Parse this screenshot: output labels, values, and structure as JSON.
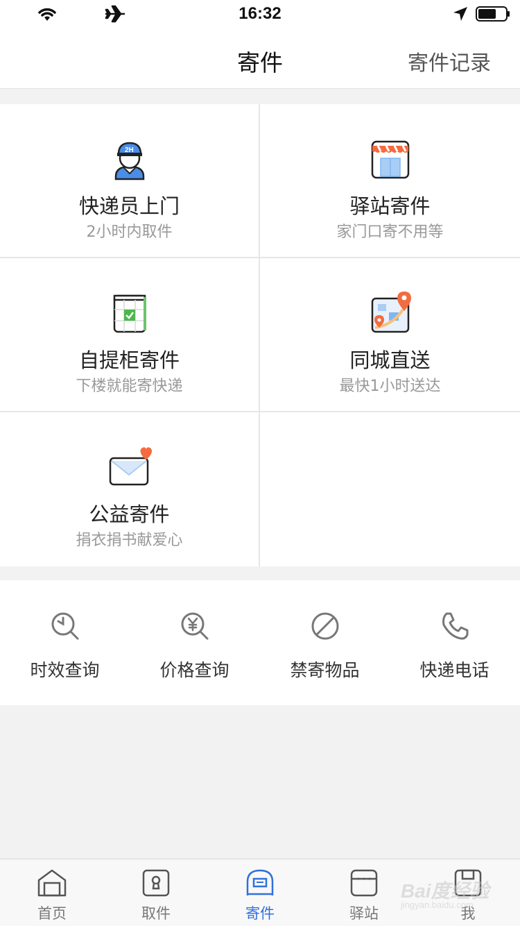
{
  "status_bar": {
    "time": "16:32"
  },
  "nav": {
    "title": "寄件",
    "right_link": "寄件记录"
  },
  "services": [
    {
      "label": "快递员上门",
      "sub": "2小时内取件",
      "icon": "courier-icon",
      "badge": "2H"
    },
    {
      "label": "驿站寄件",
      "sub": "家门口寄不用等",
      "icon": "store-icon"
    },
    {
      "label": "自提柜寄件",
      "sub": "下楼就能寄快递",
      "icon": "locker-icon"
    },
    {
      "label": "同城直送",
      "sub": "最快1小时送达",
      "icon": "map-pin-icon"
    },
    {
      "label": "公益寄件",
      "sub": "捐衣捐书献爱心",
      "icon": "envelope-heart-icon"
    }
  ],
  "tools": [
    {
      "label": "时效查询",
      "icon": "clock-search-icon"
    },
    {
      "label": "价格查询",
      "icon": "price-search-icon"
    },
    {
      "label": "禁寄物品",
      "icon": "prohibited-icon"
    },
    {
      "label": "快递电话",
      "icon": "phone-icon"
    }
  ],
  "tabs": [
    {
      "label": "首页",
      "icon": "home-icon",
      "active": false
    },
    {
      "label": "取件",
      "icon": "pickup-icon",
      "active": false
    },
    {
      "label": "寄件",
      "icon": "send-icon",
      "active": true
    },
    {
      "label": "驿站",
      "icon": "station-icon",
      "active": false
    },
    {
      "label": "我",
      "icon": "profile-icon",
      "active": false
    }
  ],
  "watermark": {
    "main": "Bai度经验",
    "sub": "jingyan.baidu.com"
  },
  "colors": {
    "accent": "#2f6fde",
    "background": "#f2f2f2",
    "orange": "#f36b3f",
    "green": "#4cb84c",
    "blue_light": "#7eb6f2"
  }
}
